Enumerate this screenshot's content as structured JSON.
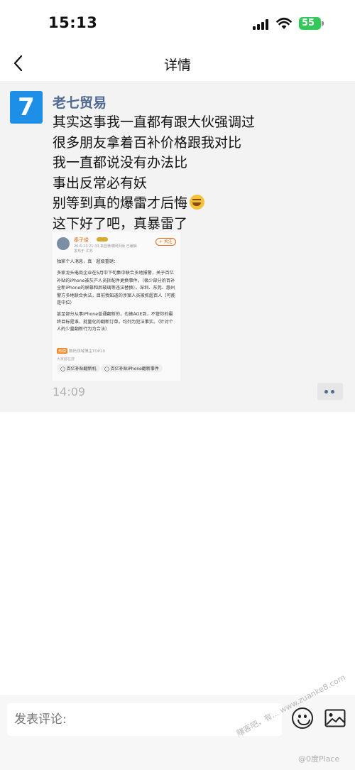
{
  "status": {
    "time": "15:13",
    "battery": "55"
  },
  "nav": {
    "title": "详情"
  },
  "post": {
    "avatar_letter": "7",
    "username": "老七贸易",
    "lines": [
      "其实这事我一直都有跟大伙强调过",
      "很多朋友拿着百补价格跟我对比",
      "我一直都说没有办法比",
      "事出反常必有妖",
      "别等到真的爆雷才后悔",
      "这下好了吧，真暴雷了"
    ],
    "time": "14:09"
  },
  "embedded": {
    "name": "秦子俊",
    "meta": "26-6-13 21:33  来自微博网页版  已编辑",
    "location": "发布于 江苏",
    "follow": "+ 关注",
    "para1": "独家个人消息，真 · 超级重磅：",
    "para2": "多家龙头电商企业在5月中下旬集中联合多地报警，关于百亿补贴的iPhone被灰产人员拆配件更换事件。（极少部分的百补全新iPhone的屏幕和后玻璃等违法替换）。深圳、东莞、惠州警方多地联合执法，目前我知道的涉案人员被抓超百人（可能是中位）",
    "para3": "甚至部分从事iPhone普通翻新的，也被AOE到，不管你的最终目标是谁，批量化的翻新订单，均列为犯法事实。（针对个人的少量翻新行为为合法）",
    "tag_badge": "热榜",
    "tag_text": "数码领域博主TOP10",
    "search_title": "大家都在搜",
    "chips": [
      "百亿补贴翻新机",
      "百亿补贴iPhone翻新事件"
    ]
  },
  "comment": {
    "placeholder": "发表评论:"
  },
  "watermark": {
    "text1": "赚客吧，有...",
    "text2": "@0度Place",
    "text3": "www.zuanke8.com"
  }
}
